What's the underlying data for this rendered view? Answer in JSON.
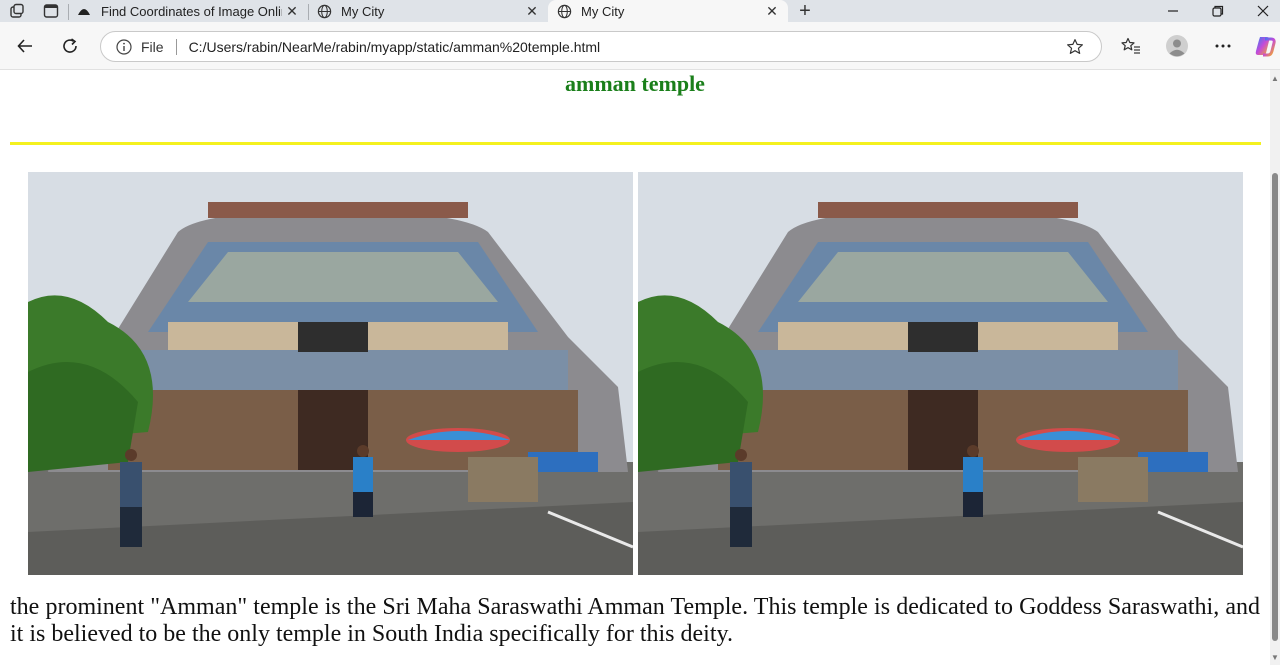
{
  "browser": {
    "tabs": [
      {
        "title": "Find Coordinates of Image Online",
        "icon": "hat-favicon-icon",
        "active": false
      },
      {
        "title": "My City",
        "icon": "globe-icon",
        "active": false
      },
      {
        "title": "My City",
        "icon": "globe-icon",
        "active": true
      }
    ],
    "address": {
      "scheme_label": "File",
      "url": "C:/Users/rabin/NearMe/rabin/myapp/static/amman%20temple.html"
    }
  },
  "page": {
    "heading": "amman temple",
    "heading_color": "#1a7f1a",
    "rule_color": "#f4f11f",
    "images": [
      {
        "alt": "Temple gopuram with colorful sculptures and people in front"
      },
      {
        "alt": "Temple gopuram with colorful sculptures and people in front"
      }
    ],
    "paragraph": "the prominent \"Amman\" temple is the Sri Maha Saraswathi Amman Temple. This temple is dedicated to Goddess Saraswathi, and it is believed to be the only temple in South India specifically for this deity."
  }
}
